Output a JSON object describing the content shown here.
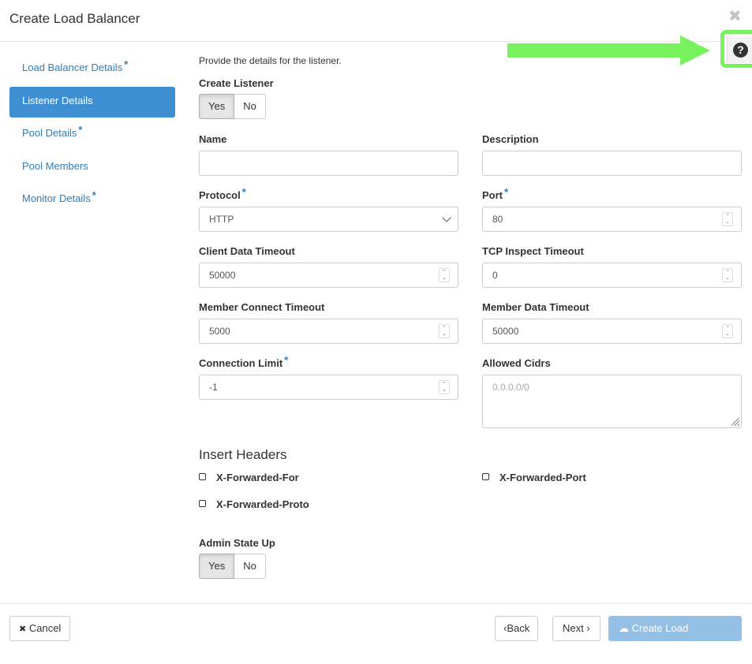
{
  "modal": {
    "title": "Create Load Balancer",
    "close_icon": "✖"
  },
  "help": {
    "icon": "?"
  },
  "sidebar": {
    "items": [
      {
        "label": "Load Balancer Details",
        "required": "*",
        "active": false
      },
      {
        "label": "Listener Details",
        "required": "",
        "active": true
      },
      {
        "label": "Pool Details",
        "required": "*",
        "active": false
      },
      {
        "label": "Pool Members",
        "required": "",
        "active": false
      },
      {
        "label": "Monitor Details",
        "required": "*",
        "active": false
      }
    ]
  },
  "form": {
    "intro": "Provide the details for the listener.",
    "create_listener": {
      "label": "Create Listener",
      "yes": "Yes",
      "no": "No",
      "selected": "Yes"
    },
    "name": {
      "label": "Name",
      "value": ""
    },
    "description": {
      "label": "Description",
      "value": ""
    },
    "protocol": {
      "label": "Protocol",
      "required": "*",
      "value": "HTTP"
    },
    "port": {
      "label": "Port",
      "required": "*",
      "value": "80"
    },
    "client_data_timeout": {
      "label": "Client Data Timeout",
      "value": "50000"
    },
    "tcp_inspect_timeout": {
      "label": "TCP Inspect Timeout",
      "value": "0"
    },
    "member_connect_timeout": {
      "label": "Member Connect Timeout",
      "value": "5000"
    },
    "member_data_timeout": {
      "label": "Member Data Timeout",
      "value": "50000"
    },
    "connection_limit": {
      "label": "Connection Limit",
      "required": "*",
      "value": "-1"
    },
    "allowed_cidrs": {
      "label": "Allowed Cidrs",
      "placeholder": "0.0.0.0/0"
    },
    "insert_headers": {
      "title": "Insert Headers",
      "x_forwarded_for": "X-Forwarded-For",
      "x_forwarded_port": "X-Forwarded-Port",
      "x_forwarded_proto": "X-Forwarded-Proto"
    },
    "admin_state_up": {
      "label": "Admin State Up",
      "yes": "Yes",
      "no": "No",
      "selected": "Yes"
    }
  },
  "footer": {
    "cancel": "Cancel",
    "back": "Back",
    "next": "Next",
    "create": "Create Load Balancer"
  },
  "colors": {
    "accent": "#3d8fd1",
    "link": "#2e7db9",
    "annotation": "#77f25e",
    "primary_disabled": "#94c0e6"
  }
}
